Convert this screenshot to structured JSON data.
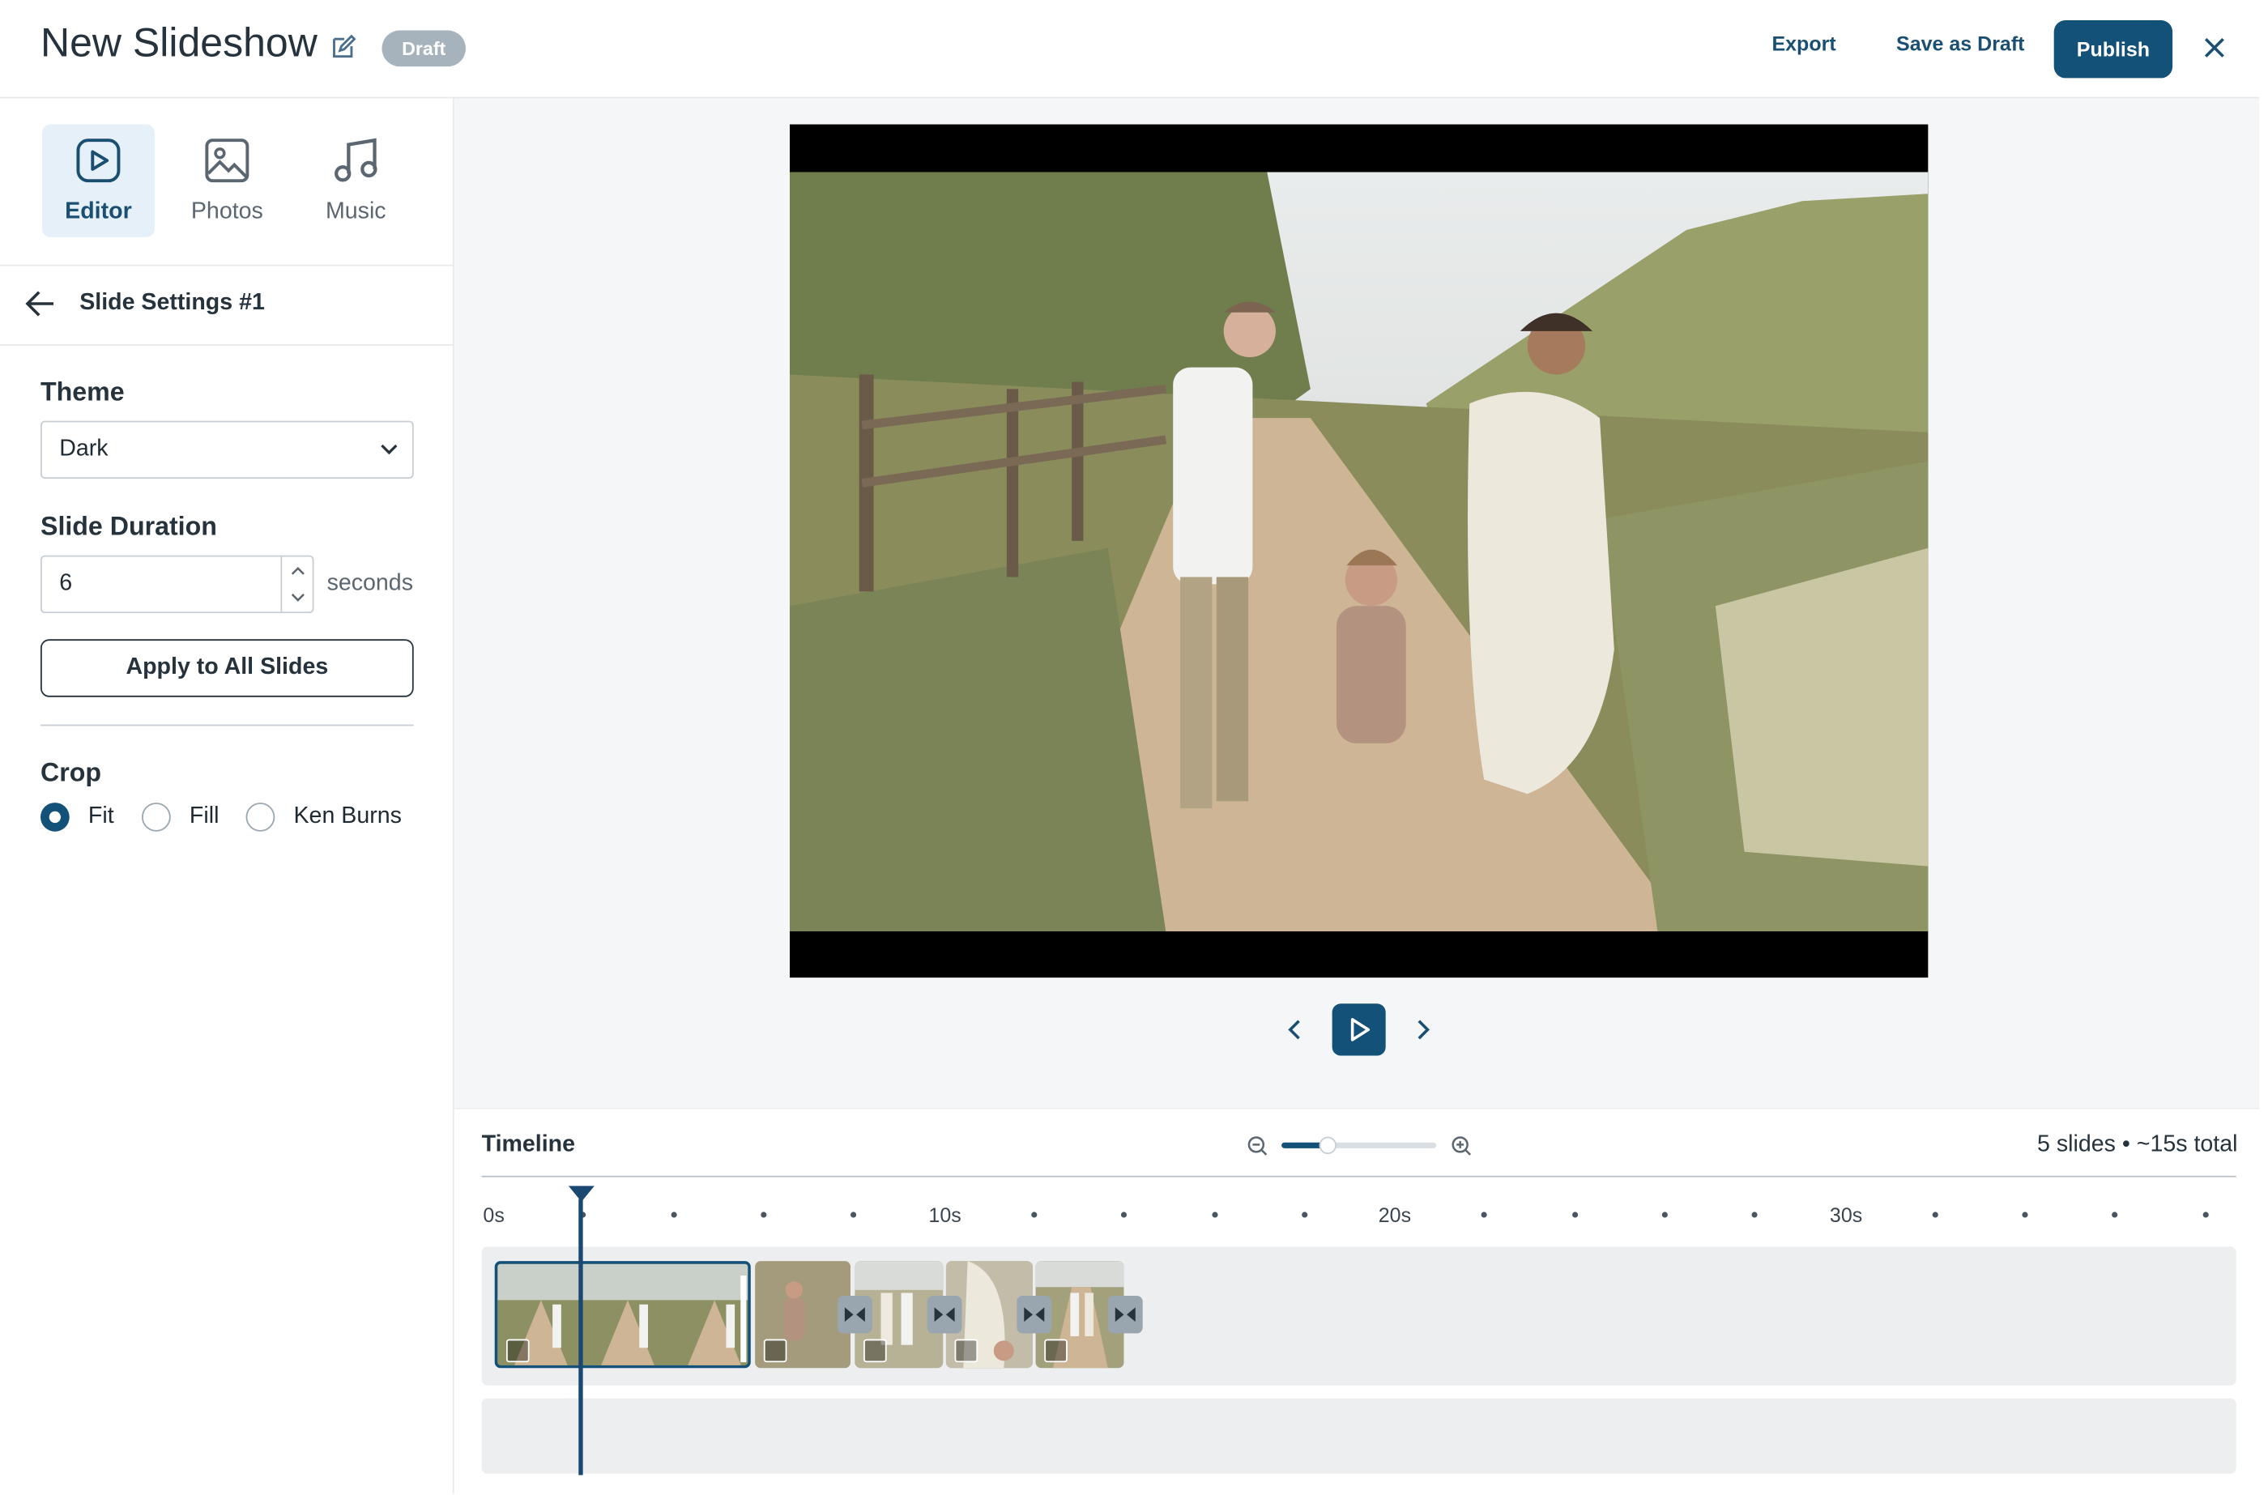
{
  "header": {
    "title": "New Slideshow",
    "badge": "Draft",
    "export_label": "Export",
    "save_draft_label": "Save as Draft",
    "publish_label": "Publish"
  },
  "sidebar": {
    "tabs": [
      {
        "label": "Editor",
        "icon": "play-square-icon",
        "active": true
      },
      {
        "label": "Photos",
        "icon": "image-icon",
        "active": false
      },
      {
        "label": "Music",
        "icon": "music-note-icon",
        "active": false
      }
    ],
    "settings_title": "Slide Settings #1",
    "theme": {
      "label": "Theme",
      "value": "Dark"
    },
    "duration": {
      "label": "Slide Duration",
      "value": "6",
      "unit": "seconds"
    },
    "apply_label": "Apply to All Slides",
    "crop": {
      "label": "Crop",
      "options": [
        {
          "label": "Fit",
          "selected": true
        },
        {
          "label": "Fill",
          "selected": false
        },
        {
          "label": "Ken Burns",
          "selected": false
        }
      ]
    }
  },
  "timeline": {
    "title": "Timeline",
    "summary": "5 slides • ~15s total",
    "zoom_level": 0.3,
    "ticks": [
      "0s",
      "10s",
      "20s",
      "30s"
    ],
    "clips": 5
  },
  "colors": {
    "accent": "#145179",
    "badge": "#a7b3bc",
    "active_tab_bg": "#e6f0f9"
  }
}
